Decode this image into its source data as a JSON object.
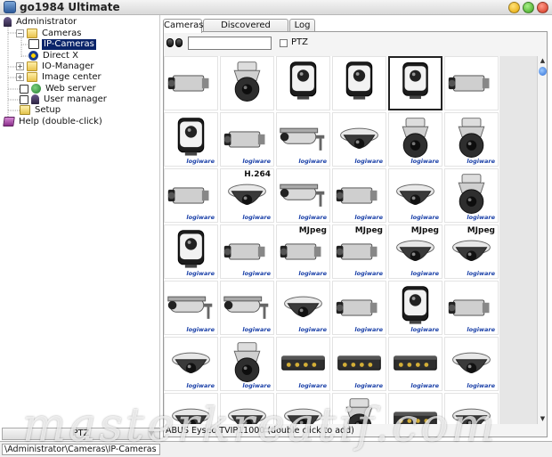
{
  "window": {
    "title": "go1984 Ultimate"
  },
  "tree": {
    "items": [
      {
        "label": "Administrator",
        "icon": "admin-user-icon"
      },
      {
        "label": "Cameras",
        "icon": "folder-icon"
      },
      {
        "label": "IP-Cameras",
        "icon": "ip-camera-icon",
        "selected": true
      },
      {
        "label": "Direct X",
        "icon": "directx-icon"
      },
      {
        "label": "IO-Manager",
        "icon": "folder-icon"
      },
      {
        "label": "Image center",
        "icon": "folder-icon"
      },
      {
        "label": "Web server",
        "icon": "globe-icon"
      },
      {
        "label": "User manager",
        "icon": "users-icon"
      },
      {
        "label": "Setup",
        "icon": "setup-icon"
      },
      {
        "label": "Help (double-click)",
        "icon": "help-book-icon"
      }
    ]
  },
  "ptz_bar": {
    "label": "PTZ"
  },
  "status_path": "\\Administrator\\Cameras\\IP-Cameras",
  "tabs": [
    {
      "label": "Cameras",
      "active": true
    },
    {
      "label": "Discovered Cameras",
      "active": false
    },
    {
      "label": "Log",
      "active": false
    }
  ],
  "filter": {
    "search_value": "",
    "ptz_label": "PTZ",
    "ptz_checked": false
  },
  "camera_grid": {
    "columns": 6,
    "rows": 7,
    "vendor_text": "logiware",
    "badges": {
      "h264": "H.264",
      "mjpeg": "MJpeg"
    },
    "cells": [
      {
        "kind": "box",
        "vendor": false
      },
      {
        "kind": "ptzdome",
        "vendor": false
      },
      {
        "kind": "cube",
        "vendor": false
      },
      {
        "kind": "cube",
        "vendor": false
      },
      {
        "kind": "cube",
        "vendor": false,
        "selected": true
      },
      {
        "kind": "box",
        "vendor": false
      },
      {
        "kind": "cube",
        "vendor": true
      },
      {
        "kind": "box",
        "vendor": true
      },
      {
        "kind": "bullet",
        "vendor": true
      },
      {
        "kind": "dome",
        "vendor": true
      },
      {
        "kind": "ptzdome",
        "vendor": true
      },
      {
        "kind": "ptzdome",
        "vendor": true
      },
      {
        "kind": "box",
        "vendor": true
      },
      {
        "kind": "dome",
        "vendor": true,
        "badge": "h264"
      },
      {
        "kind": "bullet",
        "vendor": true
      },
      {
        "kind": "box",
        "vendor": true
      },
      {
        "kind": "dome",
        "vendor": true
      },
      {
        "kind": "ptzdome",
        "vendor": true
      },
      {
        "kind": "cube",
        "vendor": true
      },
      {
        "kind": "box",
        "vendor": true
      },
      {
        "kind": "box",
        "vendor": true,
        "badge": "mjpeg"
      },
      {
        "kind": "box",
        "vendor": true,
        "badge": "mjpeg"
      },
      {
        "kind": "dome",
        "vendor": true,
        "badge": "mjpeg"
      },
      {
        "kind": "dome",
        "vendor": true,
        "badge": "mjpeg"
      },
      {
        "kind": "bullet",
        "vendor": true
      },
      {
        "kind": "bullet",
        "vendor": true
      },
      {
        "kind": "dome",
        "vendor": true
      },
      {
        "kind": "box",
        "vendor": true
      },
      {
        "kind": "cube",
        "vendor": true
      },
      {
        "kind": "box",
        "vendor": true
      },
      {
        "kind": "dome",
        "vendor": true
      },
      {
        "kind": "ptzdome",
        "vendor": true
      },
      {
        "kind": "encoder",
        "vendor": true
      },
      {
        "kind": "encoder",
        "vendor": true
      },
      {
        "kind": "encoder",
        "vendor": true
      },
      {
        "kind": "dome",
        "vendor": true
      },
      {
        "kind": "dome",
        "vendor": false
      },
      {
        "kind": "dome",
        "vendor": false
      },
      {
        "kind": "dome",
        "vendor": false
      },
      {
        "kind": "ptzdome",
        "vendor": false
      },
      {
        "kind": "encoder",
        "vendor": false
      },
      {
        "kind": "dome",
        "vendor": false
      }
    ]
  },
  "camera_status": "ABUS Eyseo TVIP11000 (double click to add)",
  "watermark": "masterkreatif.com"
}
